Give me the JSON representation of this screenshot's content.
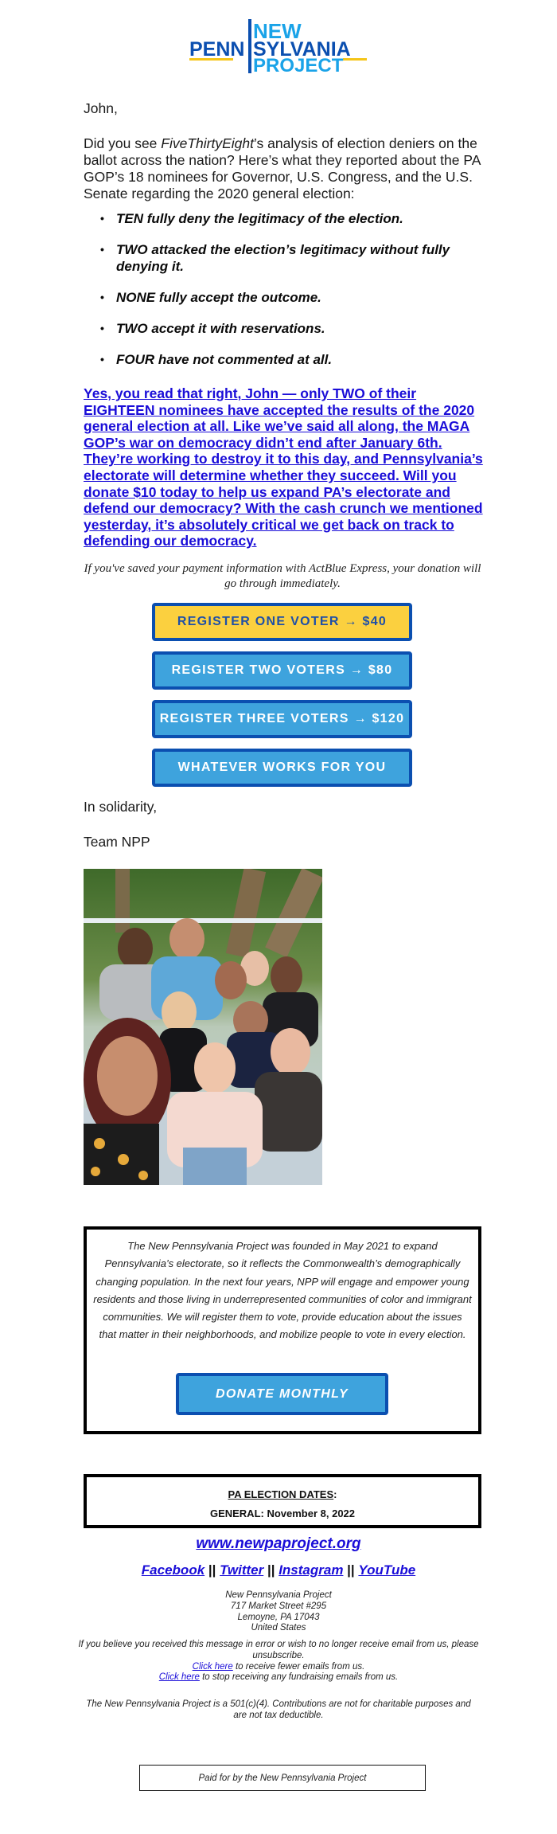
{
  "logo": {
    "line1": "NEW",
    "line2_left": "PENN",
    "line2_right": "SYLVANIA",
    "line3": "PROJECT",
    "colors": {
      "dark_blue": "#0b4fb0",
      "light_blue": "#1aa3e8",
      "yellow": "#f5c518"
    }
  },
  "greeting": "John,",
  "intro": {
    "before": "Did you see ",
    "source": "FiveThirtyEight",
    "after": "’s analysis of election deniers on the ballot across the nation? Here’s what they reported about the PA GOP’s 18 nominees for Governor, U.S. Congress, and the U.S. Senate regarding the 2020 general election:"
  },
  "facts": [
    "TEN fully deny the legitimacy of the election.",
    "TWO attacked the election’s legitimacy without fully denying it.",
    "NONE fully accept the outcome.",
    "TWO accept it with reservations.",
    "FOUR have not commented at all."
  ],
  "appeal_link": "Yes, you read that right, John — only TWO of their EIGHTEEN nominees have accepted the results of the 2020 general election at all. Like we’ve said all along, the MAGA GOP’s war on democracy didn’t end after January 6th. They’re working to destroy it to this day, and Pennsylvania’s electorate will determine whether they succeed. Will you donate $10 today to help us expand PA’s electorate and defend our democracy? With the cash crunch we mentioned yesterday, it’s absolutely critical we get back on track to defending our democracy.",
  "actblue_note": "If you've saved your payment information with ActBlue Express, your donation will go through immediately.",
  "donate_buttons": [
    {
      "label": "REGISTER ONE VOTER → $40",
      "style": "yellow"
    },
    {
      "label": "REGISTER TWO VOTERS → $80",
      "style": "blue"
    },
    {
      "label": "REGISTER THREE VOTERS → $120",
      "style": "blue"
    },
    {
      "label": "WHATEVER WORKS FOR YOU",
      "style": "blue"
    }
  ],
  "signoff": "In solidarity,",
  "signature": "Team NPP",
  "photo": {
    "description": "Group selfie of New Pennsylvania Project team on a deck"
  },
  "about": {
    "text": "The New Pennsylvania Project was founded in May 2021 to expand Pennsylvania’s electorate, so it reflects the Commonwealth’s demographically changing population. In the next four years, NPP will engage and empower young residents and those living in underrepresented communities of color and immigrant communities. We will register them to vote, provide education about the issues that matter in their neighborhoods, and mobilize people to vote in every election.",
    "button_label": "DONATE MONTHLY"
  },
  "election_dates": {
    "title": "PA ELECTION DATES",
    "title_suffix": ":",
    "general": "GENERAL: November 8, 2022"
  },
  "website": "www.newpaproject.org",
  "social": {
    "links": [
      "Facebook",
      "Twitter",
      "Instagram",
      "YouTube"
    ],
    "separator": " || "
  },
  "address": {
    "org": "New Pennsylvania Project",
    "street": "717 Market Street #295",
    "city": "Lemoyne, PA 17043",
    "country": "United States"
  },
  "unsubscribe": {
    "line1": "If you believe you received this message in error or wish to no longer receive email from us, please unsubscribe.",
    "fewer_link": "Click here",
    "fewer_text": " to receive fewer emails from us.",
    "stop_link": "Click here",
    "stop_text": " to stop receiving any fundraising emails from us."
  },
  "legal": "The New Pennsylvania Project is a 501(c)(4). Contributions are not for charitable purposes and are not tax deductible.",
  "paid_for": "Paid for by the New Pennsylvania Project"
}
